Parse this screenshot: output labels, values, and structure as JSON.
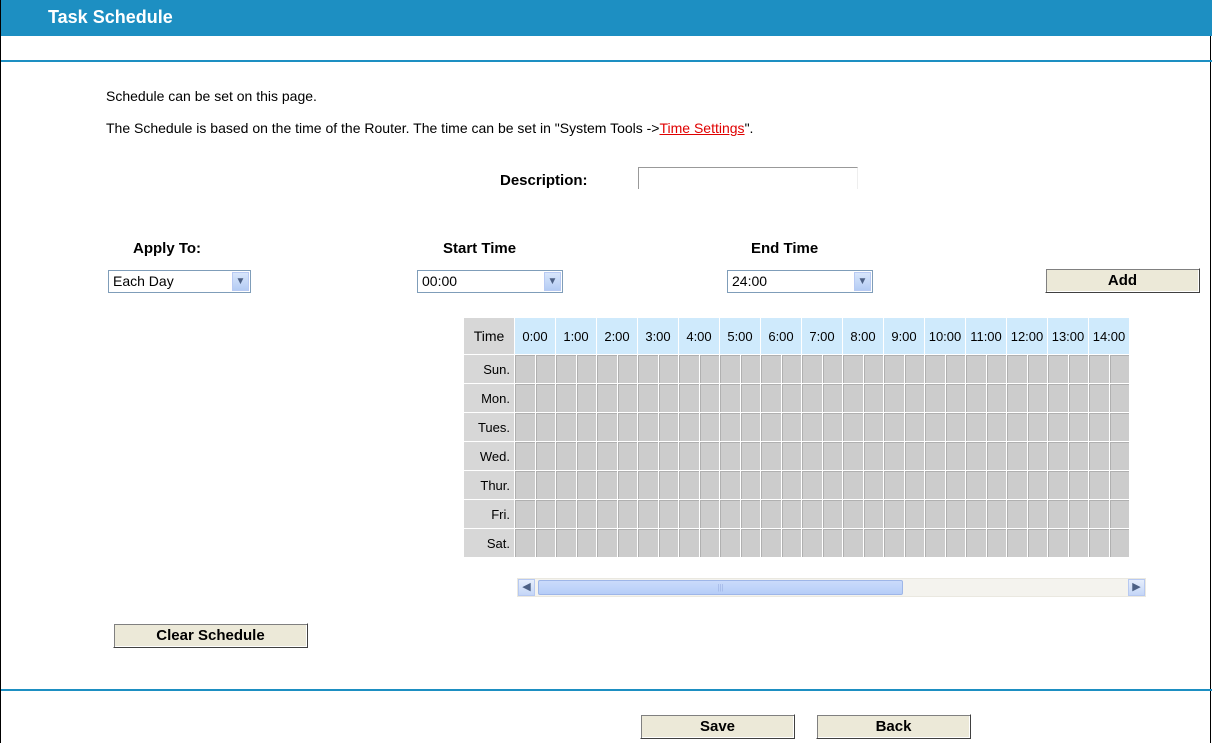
{
  "header": {
    "title": "Task Schedule"
  },
  "intro": {
    "line1": "Schedule can be set on this page.",
    "line2_prefix": "The Schedule is based on the time of the Router. The time can be set in \"System Tools ->",
    "line2_link": "Time Settings",
    "line2_suffix": "\"."
  },
  "description": {
    "label": "Description:",
    "value": ""
  },
  "apply_to": {
    "label": "Apply To:",
    "selected": "Each Day"
  },
  "start_time": {
    "label": "Start Time",
    "selected": "00:00"
  },
  "end_time": {
    "label": "End Time",
    "selected": "24:00"
  },
  "buttons": {
    "add": "Add",
    "clear": "Clear Schedule",
    "save": "Save",
    "back": "Back"
  },
  "schedule": {
    "time_header": "Time",
    "hours": [
      "0:00",
      "1:00",
      "2:00",
      "3:00",
      "4:00",
      "5:00",
      "6:00",
      "7:00",
      "8:00",
      "9:00",
      "10:00",
      "11:00",
      "12:00",
      "13:00",
      "14:00"
    ],
    "days": [
      "Sun.",
      "Mon.",
      "Tues.",
      "Wed.",
      "Thur.",
      "Fri.",
      "Sat."
    ]
  }
}
